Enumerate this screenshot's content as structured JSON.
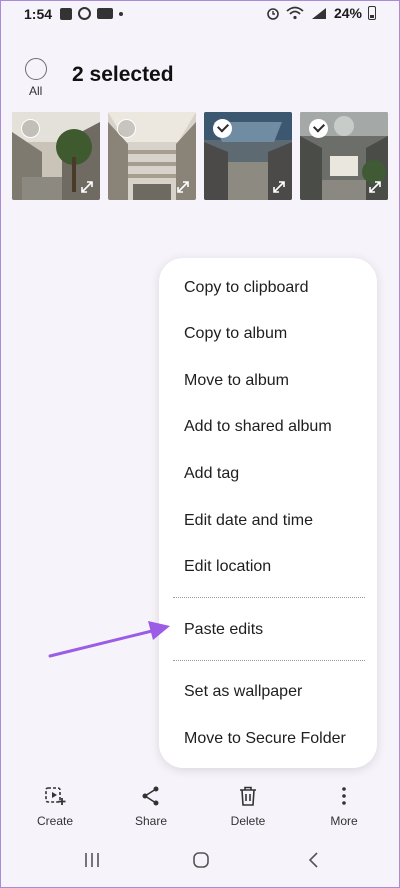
{
  "status_bar": {
    "time": "1:54",
    "battery": "24%"
  },
  "header": {
    "select_all_label": "All",
    "title": "2 selected"
  },
  "thumbnails": [
    {
      "selected": false
    },
    {
      "selected": false
    },
    {
      "selected": true
    },
    {
      "selected": true
    }
  ],
  "menu": {
    "items": [
      "Copy to clipboard",
      "Copy to album",
      "Move to album",
      "Add to shared album",
      "Add tag",
      "Edit date and time",
      "Edit location",
      "Paste edits",
      "Set as wallpaper",
      "Move to Secure Folder"
    ]
  },
  "actions": {
    "create": "Create",
    "share": "Share",
    "delete": "Delete",
    "more": "More"
  },
  "colors": {
    "annotation_arrow": "#9b5de5",
    "background": "#f7f3fa"
  }
}
